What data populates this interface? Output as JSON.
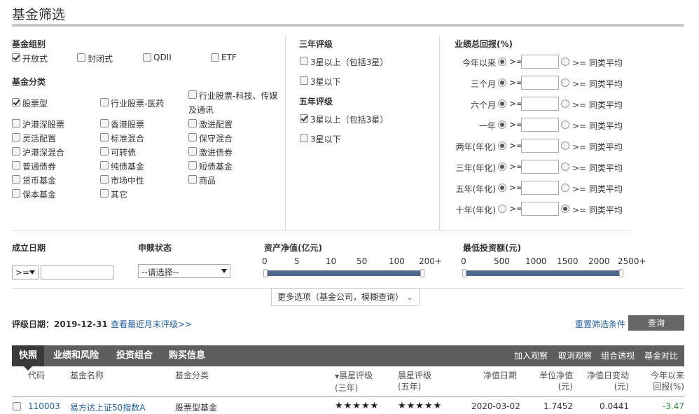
{
  "page_title": "基金筛选",
  "fund_group": {
    "heading": "基金组别",
    "options": [
      {
        "label": "开放式",
        "checked": true
      },
      {
        "label": "封闭式",
        "checked": false
      },
      {
        "label": "QDII",
        "checked": false
      },
      {
        "label": "ETF",
        "checked": false
      }
    ]
  },
  "fund_category": {
    "heading": "基金分类",
    "options": [
      {
        "label": "股票型",
        "checked": true
      },
      {
        "label": "行业股票-医药",
        "checked": false
      },
      {
        "label": "行业股票-科技、传媒",
        "label2": "及通讯",
        "checked": false
      },
      {
        "label": "沪港深股票",
        "checked": false
      },
      {
        "label": "香港股票",
        "checked": false
      },
      {
        "label": "激进配置",
        "checked": false
      },
      {
        "label": "灵活配置",
        "checked": false
      },
      {
        "label": "标准混合",
        "checked": false
      },
      {
        "label": "保守混合",
        "checked": false
      },
      {
        "label": "沪港深混合",
        "checked": false
      },
      {
        "label": "可转债",
        "checked": false
      },
      {
        "label": "激进债券",
        "checked": false
      },
      {
        "label": "普通债券",
        "checked": false
      },
      {
        "label": "纯债基金",
        "checked": false
      },
      {
        "label": "短债基金",
        "checked": false
      },
      {
        "label": "货币基金",
        "checked": false
      },
      {
        "label": "市场中性",
        "checked": false
      },
      {
        "label": "商品",
        "checked": false
      },
      {
        "label": "保本基金",
        "checked": false
      },
      {
        "label": "其它",
        "checked": false
      }
    ]
  },
  "rating3": {
    "heading": "三年评级",
    "options": [
      {
        "label": "3星以上（包括3星）",
        "checked": false
      },
      {
        "label": "3星以下",
        "checked": false
      }
    ]
  },
  "rating5": {
    "heading": "五年评级",
    "options": [
      {
        "label": "3星以上（包括3星）",
        "checked": true
      },
      {
        "label": "3星以下",
        "checked": false
      }
    ]
  },
  "returns": {
    "heading": "业绩总回报(%)",
    "ge": ">=",
    "avg_label": ">= 同类平均",
    "rows": [
      {
        "label": "今年以来",
        "mode": "value",
        "value": ""
      },
      {
        "label": "三个月",
        "mode": "value",
        "value": ""
      },
      {
        "label": "六个月",
        "mode": "value",
        "value": ""
      },
      {
        "label": "一年",
        "mode": "value",
        "value": ""
      },
      {
        "label": "两年(年化)",
        "mode": "value",
        "value": ""
      },
      {
        "label": "三年(年化)",
        "mode": "value",
        "value": ""
      },
      {
        "label": "五年(年化)",
        "mode": "value",
        "value": ""
      },
      {
        "label": "十年(年化)",
        "mode": "avg",
        "value": ""
      }
    ]
  },
  "inception": {
    "heading": "成立日期",
    "operator": ">=",
    "value": ""
  },
  "purchase_status": {
    "heading": "申赎状态",
    "selected": "--请选择--"
  },
  "net_assets": {
    "heading": "资产净值(亿元)",
    "ticks": [
      "0",
      "5",
      "10",
      "50",
      "100",
      "200+"
    ],
    "range": [
      0,
      1
    ]
  },
  "min_invest": {
    "heading": "最低投资额(元)",
    "ticks": [
      "0",
      "500",
      "1000",
      "1500",
      "2000",
      "2500+"
    ],
    "range": [
      0,
      1
    ]
  },
  "more_options": "更多选项（基金公司，模糊查询）",
  "rating_date": {
    "label": "评级日期：",
    "value": "2019-12-31",
    "link": "查看最近月末评级>>"
  },
  "reset_label": "重置筛选条件",
  "query_label": "查询",
  "tabs": [
    "快照",
    "业绩和风险",
    "投资组合",
    "购买信息"
  ],
  "actions": [
    "加入观察",
    "取消观察",
    "组合透视",
    "基金对比"
  ],
  "table": {
    "headers": {
      "code": "代码",
      "name": "基金名称",
      "category": "基金分类",
      "rating3": [
        "晨星评级",
        "(三年)"
      ],
      "rating5": [
        "晨星评级",
        "(五年)"
      ],
      "nav_date": "净值日期",
      "unit_nav": [
        "单位净值",
        "(元)"
      ],
      "nav_change": [
        "净值日变动",
        "(元)"
      ],
      "ytd": [
        "今年以来",
        "回报(%)"
      ]
    },
    "rows": [
      {
        "code": "110003",
        "name": "易方达上证50指数A",
        "category": "股票型基金",
        "rating3": "★★★★★",
        "rating5": "★★★★★",
        "nav_date": "2020-03-02",
        "unit_nav": "1.7452",
        "nav_change": "0.0441",
        "ytd": "-3.47"
      }
    ]
  },
  "colors": {
    "tabbar": "#5e5e5e",
    "tab_active": "#3a3a3a",
    "slider": "#4f6a8c",
    "link": "#1f5fa8",
    "query_button": "#666666"
  }
}
